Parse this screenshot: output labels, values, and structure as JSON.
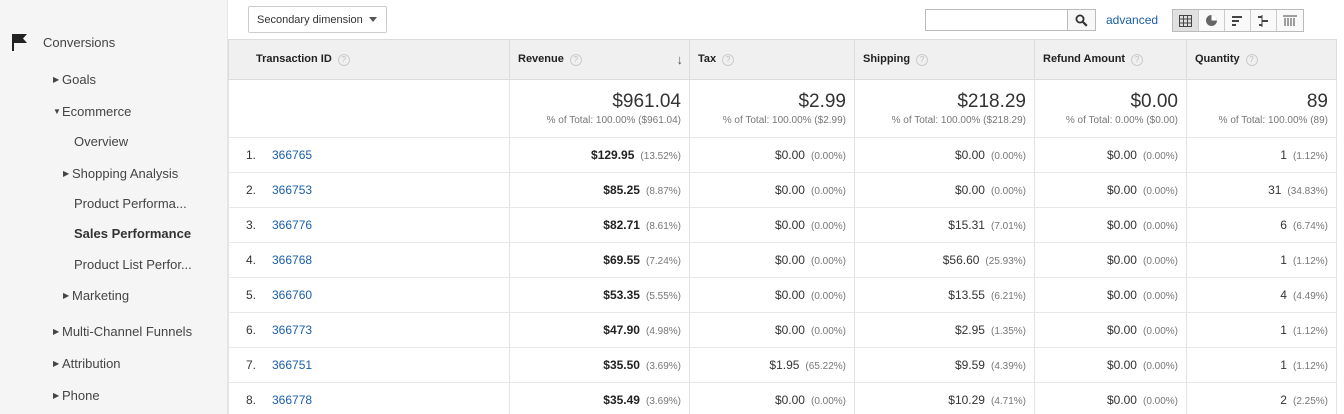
{
  "sidebar": {
    "section_label": "Conversions",
    "items": [
      {
        "label": "Goals"
      },
      {
        "label": "Ecommerce"
      },
      {
        "label": "Overview"
      },
      {
        "label": "Shopping Analysis"
      },
      {
        "label": "Product Performa..."
      },
      {
        "label": "Sales Performance"
      },
      {
        "label": "Product List Perfor..."
      },
      {
        "label": "Marketing"
      },
      {
        "label": "Multi-Channel Funnels"
      },
      {
        "label": "Attribution"
      },
      {
        "label": "Phone"
      }
    ]
  },
  "toolbar": {
    "secondary_dimension": "Secondary dimension",
    "search_placeholder": "",
    "advanced": "advanced",
    "view_icons": [
      "table-view-icon",
      "pie-view-icon",
      "performance-view-icon",
      "comparison-view-icon",
      "pivot-view-icon"
    ]
  },
  "table": {
    "headers": {
      "transaction_id": "Transaction ID",
      "revenue": "Revenue",
      "tax": "Tax",
      "shipping": "Shipping",
      "refund": "Refund Amount",
      "quantity": "Quantity"
    },
    "help_glyph": "?",
    "sort_arrow": "↓",
    "totals": {
      "revenue": {
        "value": "$961.04",
        "sub": "% of Total: 100.00% ($961.04)"
      },
      "tax": {
        "value": "$2.99",
        "sub": "% of Total: 100.00% ($2.99)"
      },
      "shipping": {
        "value": "$218.29",
        "sub": "% of Total: 100.00% ($218.29)"
      },
      "refund": {
        "value": "$0.00",
        "sub": "% of Total: 0.00% ($0.00)"
      },
      "quantity": {
        "value": "89",
        "sub": "% of Total: 100.00% (89)"
      }
    },
    "rows": [
      {
        "n": "1.",
        "id": "366765",
        "revenue": "$129.95",
        "revenue_pct": "(13.52%)",
        "tax": "$0.00",
        "tax_pct": "(0.00%)",
        "shipping": "$0.00",
        "shipping_pct": "(0.00%)",
        "refund": "$0.00",
        "refund_pct": "(0.00%)",
        "qty": "1",
        "qty_pct": "(1.12%)"
      },
      {
        "n": "2.",
        "id": "366753",
        "revenue": "$85.25",
        "revenue_pct": "(8.87%)",
        "tax": "$0.00",
        "tax_pct": "(0.00%)",
        "shipping": "$0.00",
        "shipping_pct": "(0.00%)",
        "refund": "$0.00",
        "refund_pct": "(0.00%)",
        "qty": "31",
        "qty_pct": "(34.83%)"
      },
      {
        "n": "3.",
        "id": "366776",
        "revenue": "$82.71",
        "revenue_pct": "(8.61%)",
        "tax": "$0.00",
        "tax_pct": "(0.00%)",
        "shipping": "$15.31",
        "shipping_pct": "(7.01%)",
        "refund": "$0.00",
        "refund_pct": "(0.00%)",
        "qty": "6",
        "qty_pct": "(6.74%)"
      },
      {
        "n": "4.",
        "id": "366768",
        "revenue": "$69.55",
        "revenue_pct": "(7.24%)",
        "tax": "$0.00",
        "tax_pct": "(0.00%)",
        "shipping": "$56.60",
        "shipping_pct": "(25.93%)",
        "refund": "$0.00",
        "refund_pct": "(0.00%)",
        "qty": "1",
        "qty_pct": "(1.12%)"
      },
      {
        "n": "5.",
        "id": "366760",
        "revenue": "$53.35",
        "revenue_pct": "(5.55%)",
        "tax": "$0.00",
        "tax_pct": "(0.00%)",
        "shipping": "$13.55",
        "shipping_pct": "(6.21%)",
        "refund": "$0.00",
        "refund_pct": "(0.00%)",
        "qty": "4",
        "qty_pct": "(4.49%)"
      },
      {
        "n": "6.",
        "id": "366773",
        "revenue": "$47.90",
        "revenue_pct": "(4.98%)",
        "tax": "$0.00",
        "tax_pct": "(0.00%)",
        "shipping": "$2.95",
        "shipping_pct": "(1.35%)",
        "refund": "$0.00",
        "refund_pct": "(0.00%)",
        "qty": "1",
        "qty_pct": "(1.12%)"
      },
      {
        "n": "7.",
        "id": "366751",
        "revenue": "$35.50",
        "revenue_pct": "(3.69%)",
        "tax": "$1.95",
        "tax_pct": "(65.22%)",
        "shipping": "$9.59",
        "shipping_pct": "(4.39%)",
        "refund": "$0.00",
        "refund_pct": "(0.00%)",
        "qty": "1",
        "qty_pct": "(1.12%)"
      },
      {
        "n": "8.",
        "id": "366778",
        "revenue": "$35.49",
        "revenue_pct": "(3.69%)",
        "tax": "$0.00",
        "tax_pct": "(0.00%)",
        "shipping": "$10.29",
        "shipping_pct": "(4.71%)",
        "refund": "$0.00",
        "refund_pct": "(0.00%)",
        "qty": "2",
        "qty_pct": "(2.25%)"
      }
    ]
  },
  "colors": {
    "link": "#1a5ea8",
    "sidebar_bg": "#f5f5f5",
    "header_bg": "#f0f0f0"
  }
}
